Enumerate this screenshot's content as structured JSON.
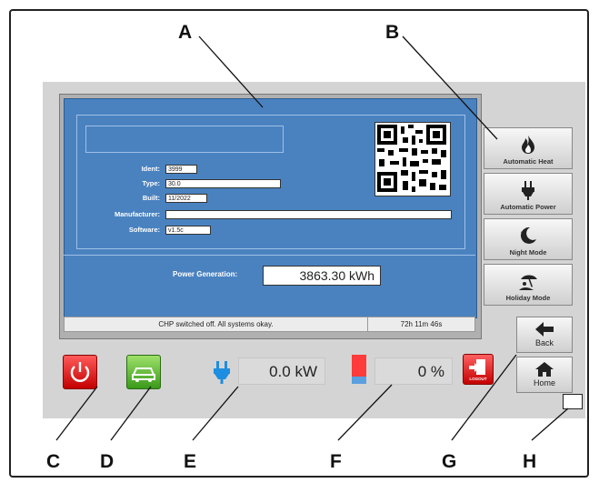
{
  "screen": {
    "fields": [
      {
        "label": "Ident:",
        "value": "3999"
      },
      {
        "label": "Type:",
        "value": "30.0"
      },
      {
        "label": "Built:",
        "value": "11/2022"
      },
      {
        "label": "Manufacturer:",
        "value": ""
      },
      {
        "label": "Software:",
        "value": "v1.5c"
      }
    ],
    "power_generation": {
      "label": "Power Generation:",
      "value": "3863.30 kWh"
    },
    "status": {
      "message": "CHP switched off. All systems okay.",
      "runtime": "72h 11m 46s"
    }
  },
  "side_menu": [
    {
      "label": "Automatic Heat",
      "icon": "flame-icon"
    },
    {
      "label": "Automatic Power",
      "icon": "plug-icon"
    },
    {
      "label": "Night Mode",
      "icon": "moon-star-icon"
    },
    {
      "label": "Holiday Mode",
      "icon": "umbrella-icon"
    }
  ],
  "nav": {
    "back_label": "Back",
    "home_label": "Home"
  },
  "bottom": {
    "power_output": "0.0 kW",
    "storage_level": "0 %",
    "logout_label": "LOGOUT"
  },
  "callouts": {
    "A": "A",
    "B": "B",
    "C": "C",
    "D": "D",
    "E": "E",
    "F": "F",
    "G": "G",
    "H": "H"
  },
  "colors": {
    "screen_blue": "#4a82c0",
    "power_red": "#e02020",
    "eco_green": "#5cb030",
    "plug_blue": "#1e8ee0",
    "storage_red": "#ff3b3b",
    "storage_blue": "#5aa0e0"
  }
}
